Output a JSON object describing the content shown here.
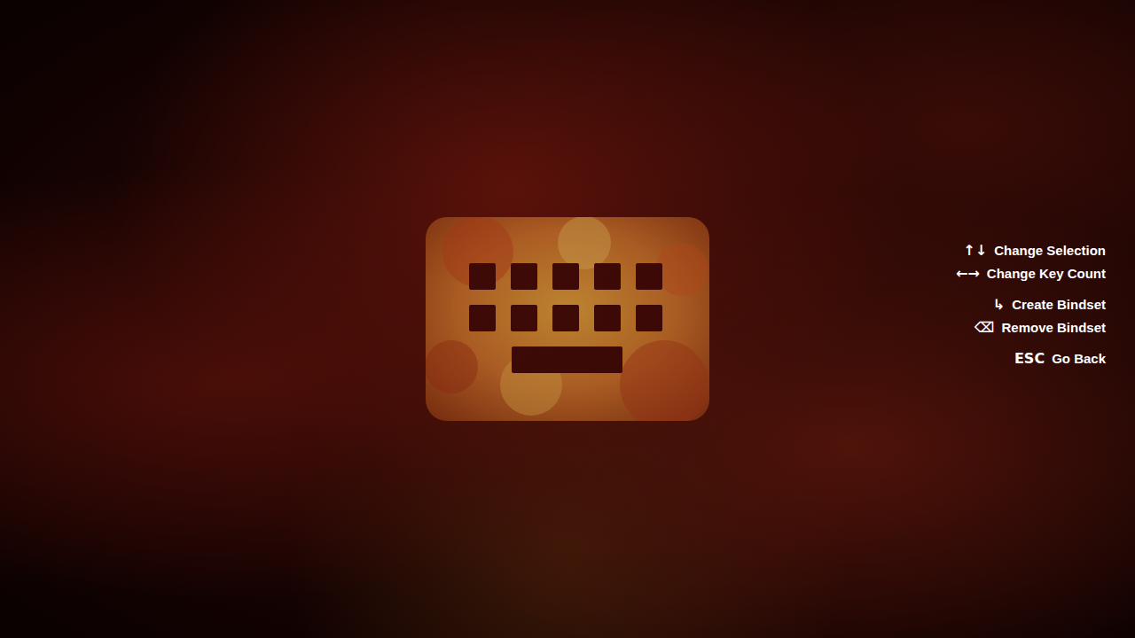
{
  "hint_groups": [
    {
      "hints": [
        {
          "key": "↑↓",
          "label": "Change Selection"
        },
        {
          "key": "←→",
          "label": "Change Key Count"
        }
      ]
    },
    {
      "hints": [
        {
          "key": "↳",
          "label": "Create Bindset"
        },
        {
          "key": "⌫",
          "label": "Remove Bindset"
        }
      ]
    },
    {
      "hints": [
        {
          "key": "ESC",
          "label": "Go Back"
        }
      ]
    }
  ]
}
